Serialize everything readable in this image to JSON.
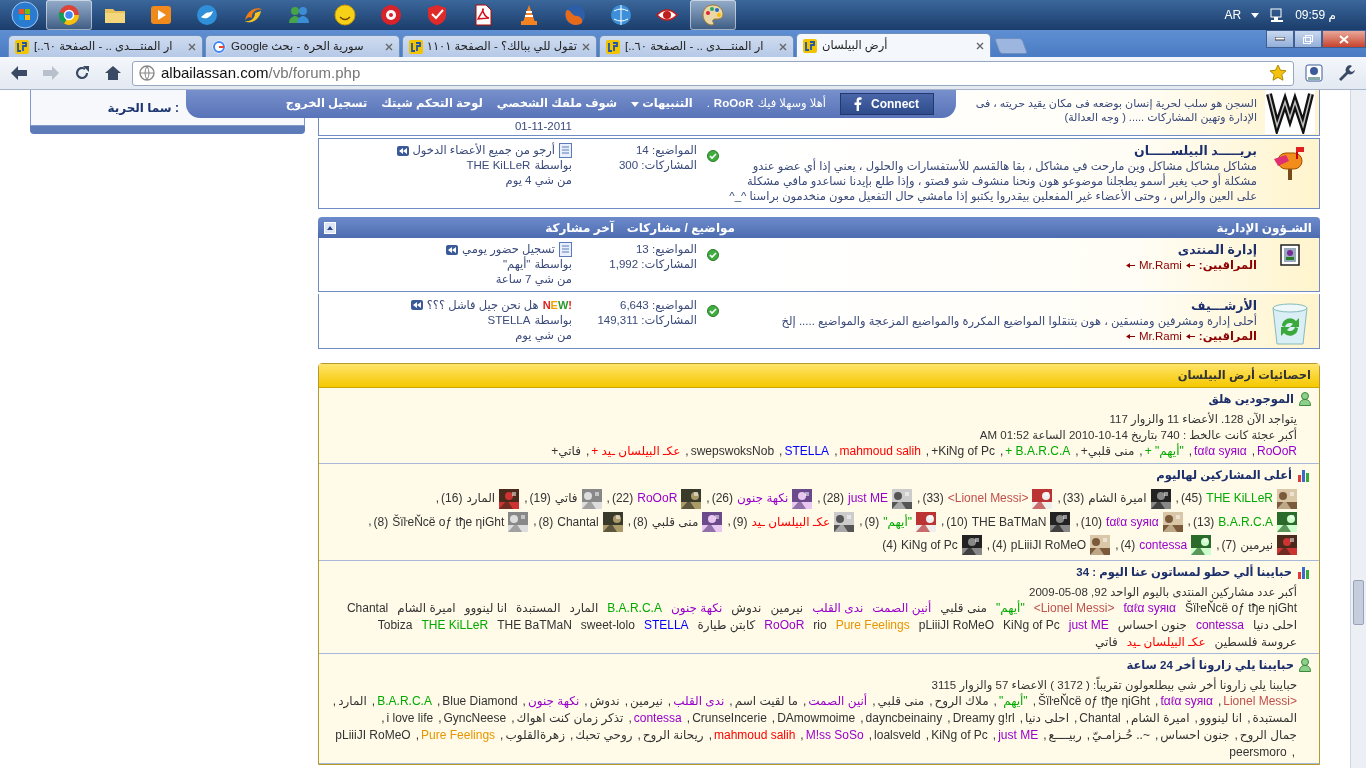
{
  "taskbar": {
    "apps": [
      {
        "kind": "browser",
        "open": true
      },
      {
        "kind": "folder",
        "open": false
      },
      {
        "kind": "media",
        "open": false
      },
      {
        "kind": "bird",
        "open": false
      },
      {
        "kind": "swirl",
        "open": false
      },
      {
        "kind": "people",
        "open": false
      },
      {
        "kind": "smiley",
        "open": false
      },
      {
        "kind": "disc",
        "open": false
      },
      {
        "kind": "shield",
        "open": false
      },
      {
        "kind": "document",
        "open": false
      },
      {
        "kind": "cone",
        "open": false
      },
      {
        "kind": "fox",
        "open": false
      },
      {
        "kind": "globe",
        "open": false
      },
      {
        "kind": "eye",
        "open": false
      },
      {
        "kind": "palette",
        "open": true
      }
    ],
    "language": "AR",
    "time": "09:59 م"
  },
  "browser": {
    "tabs": [
      {
        "title": "أرض البيلسان",
        "kind": "forum",
        "selected": true
      },
      {
        "title": "ار المنتـــدى .. - الصفحة ٦٠..]",
        "kind": "forum",
        "selected": false
      },
      {
        "title": "تقول للي ببالك؟ - الصفحة ١١٠١",
        "kind": "forum",
        "selected": false
      },
      {
        "title": "سورية الحرة - بحث Google",
        "kind": "search",
        "selected": false
      },
      {
        "title": "ار المنتـــدى .. - الصفحة ٦٠..]",
        "kind": "forum",
        "selected": false
      }
    ],
    "address": {
      "host": "albailassan.com",
      "path": "/vb/forum.php"
    }
  },
  "sidebar": {
    "label": "سما الحرية :"
  },
  "user_bar": {
    "connect": "Connect",
    "greeting": "أهلا وسهلا فيك",
    "user": "RoOoR",
    "dot": ".",
    "links": [
      {
        "label": "التنبيهات",
        "has_menu": true
      },
      {
        "label": "شوف ملفك الشخصي",
        "has_menu": false
      },
      {
        "label": "لوحة التحكم شيتك",
        "has_menu": false
      },
      {
        "label": "تسجيل الخروج",
        "has_menu": false
      }
    ]
  },
  "top_row": {
    "lines": [
      "السجن هو سلب لحرية إنسان بوضعه فى مكان يقيد حريته ، فى",
      "الإدارة وتهين المشاركات ..... ( وجه العدالة)"
    ],
    "date": "01-11-2011"
  },
  "forums": [
    {
      "kind": "mailbox",
      "title": "بريـــــد البيلســـــان",
      "description": "مشاكل مشاكل مشاكل وين مارحت في مشاكل ، بقا هالقسم للأستفسارات والحلول ، يعني إذا أي عضو عندو مشكلة أو حب يغير أسمو يطجلنا موضوعو هون ونحنا منشوف شو قصتو ، وإذا طلع بإيدنا نساعدو مافي مشكلة على العين والراس ، وحتى الأعضاء غير المفعلين بيقدروا يكتبو إذا مامشي حال التفعيل معون منخدمون براسنا ^_^",
      "topics_label": "المواضيع:",
      "topics": "14",
      "posts_label": "المشاركات:",
      "posts": "300",
      "last_post": {
        "doc_icon": true,
        "title": "أرجو من جميع الأعضاء الدخول",
        "by_label": "بواسطة",
        "author": "THE KiLLeR",
        "ago": "من شي 4 يوم"
      }
    }
  ],
  "category": {
    "title": "الشـؤون الإدارية",
    "col_stats": "مواضيع / مشاركات",
    "col_last": "آخر مشاركة",
    "forums": [
      {
        "kind": "admin",
        "title": "إدارة المنتدى",
        "moderators_label": "المراقبين:",
        "moderator": "Mr.Rami",
        "topics_label": "المواضيع:",
        "topics": "13",
        "posts_label": "المشاركات:",
        "posts": "1,992",
        "last_post": {
          "doc_icon": true,
          "title": "تسجيل حضور يومي",
          "by_label": "بواسطة",
          "author": "\"أيهم\"",
          "ago": "من شي 7 ساعة"
        }
      },
      {
        "kind": "recycle",
        "title": "الأرشـــيف",
        "description": "أحلى إدارة ومشرفين ومنسقين ، هون بتنقلوا المواضيع المكررة والمواضيع المزعجة والمواضيع ..... إلخ",
        "moderators_label": "المراقبين:",
        "moderator": "Mr.Rami",
        "topics_label": "المواضيع:",
        "topics": "6,643",
        "posts_label": "المشاركات:",
        "posts": "149,311",
        "last_post": {
          "doc_icon": false,
          "badge": "NEW!",
          "title": "هل نحن جيل فاشل ؟؟؟",
          "by_label": "بواسطة",
          "author": "STELLA",
          "ago": "من شي يوم"
        }
      }
    ]
  },
  "stats": {
    "title": "احصائيات أرض البيلسان",
    "sections": [
      {
        "kind": "online",
        "title": "الموجودين هلق",
        "lines": [
          "يتواجد الآن 128. الأعضاء 11 والزوار 117",
          "أكبر عجئة كانت عالخط : 740 بتاريخ 14-10-2010 الساعة 01:52 AM"
        ],
        "separator": ",",
        "members": [
          {
            "name": "RoOoR",
            "color": "#9900cc"
          },
          {
            "name": "ƭαℓα syяια",
            "color": "#9900cc"
          },
          {
            "name": "\"أيهم\" +",
            "color": "#00aa00"
          },
          {
            "name": "منى قلبي+",
            "color": "#333333"
          },
          {
            "name": "B.A.R.C.A +",
            "color": "#00aa00"
          },
          {
            "name": "KiNg of Pc+",
            "color": "#333333"
          },
          {
            "name": "mahmoud salih",
            "color": "#ff0000"
          },
          {
            "name": "STELLA",
            "color": "#0000ff"
          },
          {
            "name": "swepswoksNob",
            "color": "#333333"
          },
          {
            "name": "عكـ البيلسان ـيد +",
            "color": "#ff0000"
          },
          {
            "name": "فاتي+",
            "color": "#333333"
          }
        ]
      },
      {
        "kind": "top",
        "title": "أعلى المشاركين لهاليوم",
        "separator": ",",
        "posters": [
          {
            "name": "THE KiLLeR",
            "count": "(45)",
            "color": "#00aa00"
          },
          {
            "name": "اميرة الشام",
            "count": "(33)",
            "color": "#333333"
          },
          {
            "name": "<Lionel Messi>",
            "count": "(33)",
            "color": "#c0504d"
          },
          {
            "name": "just ME",
            "count": "(28)",
            "color": "#9900cc"
          },
          {
            "name": "نكهة جنون",
            "count": "(26)",
            "color": "#9900cc"
          },
          {
            "name": "RoOoR",
            "count": "(22)",
            "color": "#9900cc"
          },
          {
            "name": "فاتي",
            "count": "(19)",
            "color": "#333333"
          },
          {
            "name": "المارد",
            "count": "(16)",
            "color": "#333333"
          },
          {
            "name": "B.A.R.C.A",
            "count": "(13)",
            "color": "#00aa00"
          },
          {
            "name": "ƭαℓα syяια",
            "count": "(10)",
            "color": "#9900cc"
          },
          {
            "name": "THE BaTMaN",
            "count": "(10)",
            "color": "#333333"
          },
          {
            "name": "\"أيهم\"",
            "count": "(9)",
            "color": "#00aa00"
          },
          {
            "name": "عكـ البيلسان ـيد",
            "count": "(9)",
            "color": "#ff0000"
          },
          {
            "name": "منى قلبي",
            "count": "(8)",
            "color": "#333333"
          },
          {
            "name": "Chantal",
            "count": "(8)",
            "color": "#333333"
          },
          {
            "name": "ŠïŀeŇcë oƒ tђe ηiGht",
            "count": "(8)",
            "color": "#333333"
          },
          {
            "name": "نيرمين",
            "count": "(7)",
            "color": "#333333"
          },
          {
            "name": "contessa",
            "count": "(4)",
            "color": "#9900cc"
          },
          {
            "name": "pLiiiJI RoMeO",
            "count": "(4)",
            "color": "#333333"
          },
          {
            "name": "KiNg of Pc",
            "count": "(4)",
            "color": "#333333"
          }
        ]
      },
      {
        "kind": "today",
        "title": "حبايبنا ألي حطو لمساتون عنا اليوم : 34",
        "lines": [
          "أكبر عدد مشاركين المنتدى باليوم الواحد 92, 08-05-2009"
        ],
        "members": [
          {
            "name": "ŠïŀeŇcë oƒ tђe ηiGht",
            "color": "#333333"
          },
          {
            "name": "ƭαℓα syяια",
            "color": "#9900cc"
          },
          {
            "name": "<Lionel Messi>",
            "color": "#c0504d"
          },
          {
            "name": "\"أيهم\"",
            "color": "#00aa00"
          },
          {
            "name": "منى قلبي",
            "color": "#333333"
          },
          {
            "name": "أنين الصمت",
            "color": "#9900cc"
          },
          {
            "name": "ندى القلب",
            "color": "#9900cc"
          },
          {
            "name": "نيرمين",
            "color": "#333333"
          },
          {
            "name": "ندوش",
            "color": "#333333"
          },
          {
            "name": "نكهة جنون",
            "color": "#9900cc"
          },
          {
            "name": "B.A.R.C.A",
            "color": "#00aa00"
          },
          {
            "name": "المارد",
            "color": "#333333"
          },
          {
            "name": "المستبدة",
            "color": "#333333"
          },
          {
            "name": "انا لينووو",
            "color": "#333333"
          },
          {
            "name": "اميرة الشام",
            "color": "#333333"
          },
          {
            "name": "Chantal",
            "color": "#333333"
          },
          {
            "name": "احلى دنيا",
            "color": "#333333"
          },
          {
            "name": "contessa",
            "color": "#9900cc"
          },
          {
            "name": "جنون احساس",
            "color": "#333333"
          },
          {
            "name": "just ME",
            "color": "#9900cc"
          },
          {
            "name": "KiNg of Pc",
            "color": "#333333"
          },
          {
            "name": "pLiiiJI RoMeO",
            "color": "#333333"
          },
          {
            "name": "Pure Feelings",
            "color": "#e69500"
          },
          {
            "name": "rio",
            "color": "#333333"
          },
          {
            "name": "RoOoR",
            "color": "#9900cc"
          },
          {
            "name": "كابتن طيارة",
            "color": "#333333"
          },
          {
            "name": "STELLA",
            "color": "#0000ff"
          },
          {
            "name": "sweet-lolo",
            "color": "#333333"
          },
          {
            "name": "THE BaTMaN",
            "color": "#333333"
          },
          {
            "name": "THE KiLLeR",
            "color": "#00aa00"
          },
          {
            "name": "Tobiza",
            "color": "#333333"
          },
          {
            "name": "عروسة فلسطين",
            "color": "#333333"
          },
          {
            "name": "عكـ البيلسان ـيد",
            "color": "#ff0000"
          },
          {
            "name": "فاتي",
            "color": "#333333"
          }
        ]
      },
      {
        "kind": "day",
        "title": "حبايبنا يلي زارونا أخر 24 ساعة",
        "lines": [
          "حبايبنا يلي زارونا أخر شي بيطلعولون تقريباً: ( 3172 ) الاعضاء 57 والزوار 3115"
        ],
        "separator": ",",
        "members": [
          {
            "name": "<Lionel Messi",
            "color": "#c0504d"
          },
          {
            "name": "ƭαℓα syяια",
            "color": "#9900cc"
          },
          {
            "name": "ŠïŀeŇcë oƒ tђe ηiGht",
            "color": "#333333"
          },
          {
            "name": "\"أيهم\"",
            "color": "#00aa00"
          },
          {
            "name": "ملاك الروح",
            "color": "#333333"
          },
          {
            "name": "منى قلبي",
            "color": "#333333"
          },
          {
            "name": "أنين الصمت",
            "color": "#9900cc"
          },
          {
            "name": "ما لقيت اسم",
            "color": "#333333"
          },
          {
            "name": "ندى القلب",
            "color": "#9900cc"
          },
          {
            "name": "نيرمين",
            "color": "#333333"
          },
          {
            "name": "ندوش",
            "color": "#333333"
          },
          {
            "name": "نكهة جنون",
            "color": "#9900cc"
          },
          {
            "name": "Blue Diamond",
            "color": "#333333"
          },
          {
            "name": "B.A.R.C.A",
            "color": "#00aa00"
          },
          {
            "name": "المارد",
            "color": "#333333"
          },
          {
            "name": "المستبدة",
            "color": "#333333"
          },
          {
            "name": "انا لينووو",
            "color": "#333333"
          },
          {
            "name": "اميرة الشام",
            "color": "#333333"
          },
          {
            "name": "Chantal",
            "color": "#333333"
          },
          {
            "name": "احلى دنيا",
            "color": "#333333"
          },
          {
            "name": "Dreamy g!rl",
            "color": "#333333"
          },
          {
            "name": "dayncbeinainy",
            "color": "#333333"
          },
          {
            "name": "DAmowmoime",
            "color": "#333333"
          },
          {
            "name": "CrunseIncerie",
            "color": "#333333"
          },
          {
            "name": "contessa",
            "color": "#9900cc"
          },
          {
            "name": "تذكر زمان كنت اهواك",
            "color": "#333333"
          },
          {
            "name": "GyncNeese",
            "color": "#333333"
          },
          {
            "name": "i love life",
            "color": "#333333"
          },
          {
            "name": "جمال الروح",
            "color": "#333333"
          },
          {
            "name": "جنون احساس",
            "color": "#333333"
          },
          {
            "name": "~.. حُـزامـيّ",
            "color": "#333333"
          },
          {
            "name": "ربيــــع",
            "color": "#333333"
          },
          {
            "name": "just ME",
            "color": "#9900cc"
          },
          {
            "name": "KiNg of Pc",
            "color": "#333333"
          },
          {
            "name": "loalsveld",
            "color": "#333333"
          },
          {
            "name": "M!ss SoSo",
            "color": "#9900cc"
          },
          {
            "name": "mahmoud salih",
            "color": "#ff0000"
          },
          {
            "name": "ريحانة الروح",
            "color": "#333333"
          },
          {
            "name": "روحي تحبك",
            "color": "#333333"
          },
          {
            "name": "زهرةالقلوب",
            "color": "#333333"
          },
          {
            "name": "Pure Feelings",
            "color": "#e69500"
          },
          {
            "name": "pLiiiJI RoMeO",
            "color": "#333333"
          },
          {
            "name": "peersmoro",
            "color": "#333333"
          }
        ]
      }
    ]
  }
}
